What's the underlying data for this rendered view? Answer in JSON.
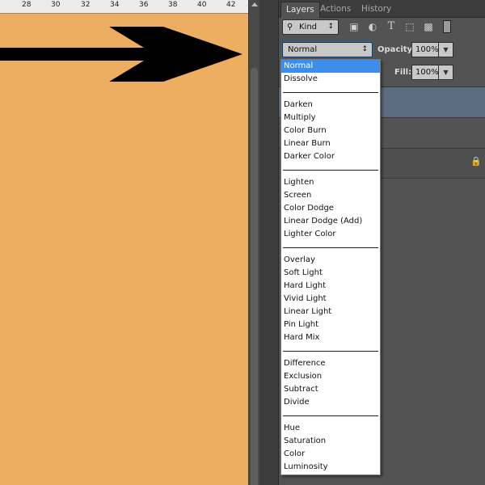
{
  "ruler": {
    "labels": [
      "28",
      "30",
      "32",
      "34",
      "36",
      "38",
      "40",
      "42"
    ]
  },
  "canvas": {
    "fill_color": "#eeae61",
    "shape": "arrow-right-icon"
  },
  "panel": {
    "tabs": [
      {
        "label": "Layers",
        "active": true
      },
      {
        "label": "Actions",
        "active": false
      },
      {
        "label": "History",
        "active": false
      }
    ],
    "filter": {
      "kind_label": "Kind",
      "icons": [
        "image-filter-icon",
        "adjustment-filter-icon",
        "type-filter-icon",
        "shape-filter-icon",
        "smart-object-filter-icon",
        "filter-toggle-icon"
      ]
    },
    "blend_mode": {
      "value": "Normal"
    },
    "opacity": {
      "label": "Opacity:",
      "value": "100%"
    },
    "fill": {
      "label": "Fill:",
      "value": "100%"
    }
  },
  "blend_menu": {
    "groups": [
      [
        "Normal",
        "Dissolve"
      ],
      [
        "Darken",
        "Multiply",
        "Color Burn",
        "Linear Burn",
        "Darker Color"
      ],
      [
        "Lighten",
        "Screen",
        "Color Dodge",
        "Linear Dodge (Add)",
        "Lighter Color"
      ],
      [
        "Overlay",
        "Soft Light",
        "Hard Light",
        "Vivid Light",
        "Linear Light",
        "Pin Light",
        "Hard Mix"
      ],
      [
        "Difference",
        "Exclusion",
        "Subtract",
        "Divide"
      ],
      [
        "Hue",
        "Saturation",
        "Color",
        "Luminosity"
      ]
    ],
    "selected": "Normal",
    "highlight_color": "#3d8ee8"
  }
}
